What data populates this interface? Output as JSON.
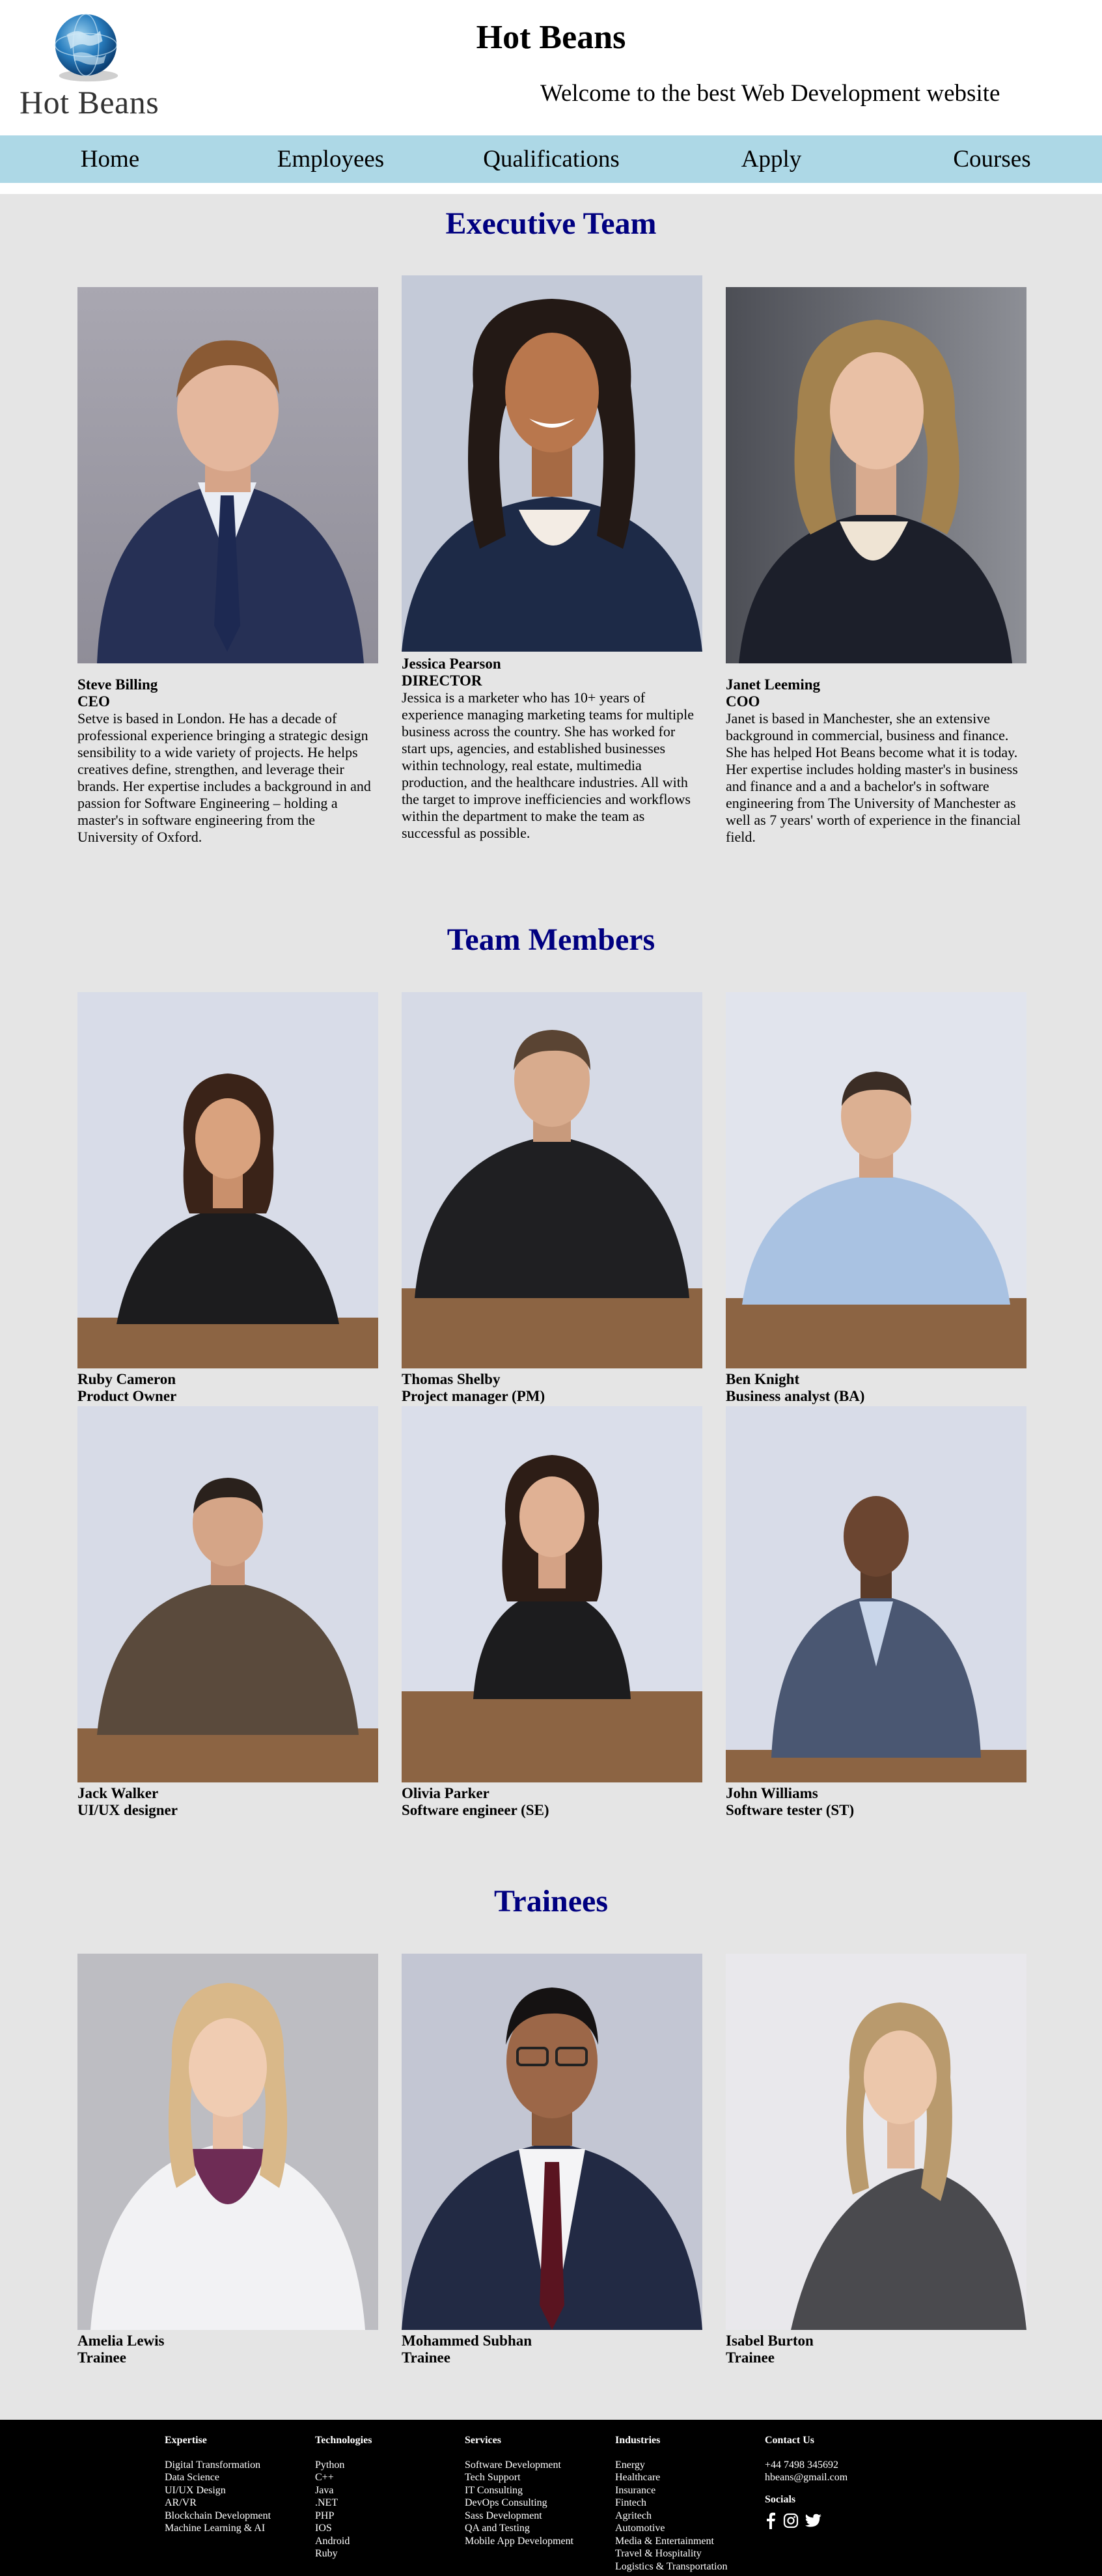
{
  "header": {
    "logo_text": "Hot Beans",
    "title": "Hot Beans",
    "tagline": "Welcome to the best Web Development website"
  },
  "nav": {
    "items": [
      "Home",
      "Employees",
      "Qualifications",
      "Apply",
      "Courses"
    ]
  },
  "executive": {
    "title": "Executive Team",
    "members": [
      {
        "name": "Steve Billing",
        "role": "CEO",
        "desc": "Setve is based in London. He has a decade of professional experience bringing a strategic design sensibility to a wide variety of projects. He helps creatives define, strengthen, and leverage their brands. Her expertise includes a background in and passion for Software Engineering – holding a master's in software engineering from the University of Oxford.",
        "photo": "man-navy-suit-portrait"
      },
      {
        "name": "Jessica Pearson",
        "role": "DIRECTOR",
        "desc": "Jessica is a marketer who has 10+ years of experience managing marketing teams for multiple business across the country. She has worked for start ups, agencies, and established businesses within technology, real estate, multimedia production, and the healthcare industries. All with the target to improve inefficiencies and workflows within the department to make the team as successful as possible.",
        "photo": "woman-navy-blazer-portrait"
      },
      {
        "name": "Janet Leeming",
        "role": "COO",
        "desc": "Janet is based in Manchester, she an extensive background in commercial, business and finance. She has helped Hot Beans become what it is today. Her expertise includes holding master's in business and finance and a and a bachelor's in software engineering from The University of Manchester as well as 7 years' worth of experience in the financial field.",
        "photo": "woman-black-blazer-portrait"
      }
    ]
  },
  "team": {
    "title": "Team Members",
    "members": [
      {
        "name": "Ruby Cameron",
        "role": "Product Owner"
      },
      {
        "name": "Thomas Shelby",
        "role": "Project manager (PM)"
      },
      {
        "name": "Ben Knight",
        "role": "Business analyst (BA)"
      },
      {
        "name": "Jack Walker",
        "role": "UI/UX designer"
      },
      {
        "name": "Olivia Parker",
        "role": "Software engineer (SE)"
      },
      {
        "name": "John Williams",
        "role": "Software tester (ST)"
      }
    ]
  },
  "trainees": {
    "title": "Trainees",
    "members": [
      {
        "name": "Amelia Lewis",
        "role": "Trainee"
      },
      {
        "name": "Mohammed Subhan",
        "role": "Trainee"
      },
      {
        "name": "Isabel Burton",
        "role": "Trainee"
      }
    ]
  },
  "footer": {
    "expertise": {
      "heading": "Expertise",
      "items": [
        "Digital Transformation",
        "Data Science",
        "UI/UX Design",
        "AR/VR",
        "Blockchain Development",
        "Machine Learning & AI"
      ]
    },
    "technologies": {
      "heading": "Technologies",
      "items": [
        "Python",
        "C++",
        "Java",
        ".NET",
        "PHP",
        "IOS",
        "Android",
        "Ruby"
      ]
    },
    "services": {
      "heading": "Services",
      "items": [
        "Software Development",
        "Tech Support",
        "IT Consulting",
        "DevOps Consulting",
        "Sass Development",
        "QA and Testing",
        "Mobile App Development"
      ]
    },
    "industries": {
      "heading": "Industries",
      "items": [
        "Energy",
        "Healthcare",
        "Insurance",
        "Fintech",
        "Agritech",
        "Automotive",
        "Media & Entertainment",
        "Travel & Hospitality",
        "Logistics & Transportation"
      ]
    },
    "contact": {
      "heading": "Contact Us",
      "phone": "+44 7498 345692",
      "email": "hbeans@gmail.com",
      "socials_heading": "Socials",
      "socials": [
        "facebook-icon",
        "instagram-icon",
        "twitter-icon"
      ]
    }
  },
  "colors": {
    "nav_bg": "#add8e6",
    "section_title": "#000080",
    "page_bg": "#e5e5e5",
    "footer_bg": "#000000"
  }
}
